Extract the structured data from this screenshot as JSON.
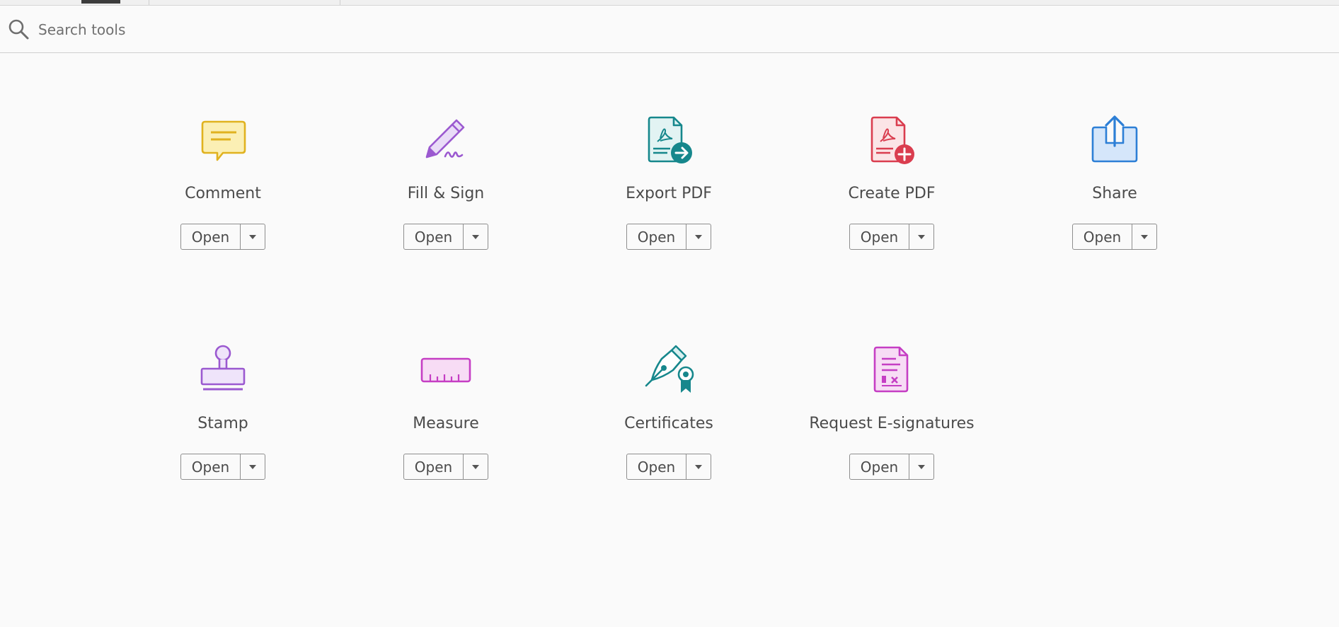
{
  "search": {
    "placeholder": "Search tools",
    "value": ""
  },
  "tools": [
    {
      "name": "Comment",
      "open_label": "Open",
      "icon": "comment-icon",
      "color": "#e8b923"
    },
    {
      "name": "Fill & Sign",
      "open_label": "Open",
      "icon": "fill-sign-icon",
      "color": "#9b59d0"
    },
    {
      "name": "Export PDF",
      "open_label": "Open",
      "icon": "export-pdf-icon",
      "color": "#16878c"
    },
    {
      "name": "Create PDF",
      "open_label": "Open",
      "icon": "create-pdf-icon",
      "color": "#da3d4f"
    },
    {
      "name": "Share",
      "open_label": "Open",
      "icon": "share-icon",
      "color": "#2d7fd6"
    },
    {
      "name": "Stamp",
      "open_label": "Open",
      "icon": "stamp-icon",
      "color": "#9b59d0"
    },
    {
      "name": "Measure",
      "open_label": "Open",
      "icon": "measure-icon",
      "color": "#c53ec4"
    },
    {
      "name": "Certificates",
      "open_label": "Open",
      "icon": "certificates-icon",
      "color": "#16878c"
    },
    {
      "name": "Request E-signatures",
      "open_label": "Open",
      "icon": "request-esignatures-icon",
      "color": "#c53ec4"
    }
  ]
}
